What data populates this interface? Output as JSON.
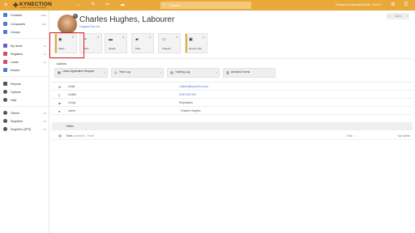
{
  "topbar": {
    "menu_icon": "hamburger-icon",
    "logo_text": "KYNECTION",
    "logo_tagline": "CONNECTING YOUR BUSINESS",
    "icons": [
      "back-arrow-icon",
      "edit-icon",
      "wrench-icon",
      "cloud-upload-icon"
    ],
    "search_placeholder": "Search",
    "user_label": "Everyone (Kynection/2018) / 1001 ▾",
    "right_icons": [
      "gear-icon",
      "menu-icon"
    ],
    "color": "#e8a93a"
  },
  "sidebar": {
    "items": [
      {
        "label": "Contacts",
        "count": "2011",
        "color": "#4a7bd0"
      },
      {
        "label": "Companies",
        "count": "201",
        "color": "#4a7bd0"
      },
      {
        "label": "Groups",
        "count": "",
        "color": "#4a7bd0"
      },
      {
        "label": "My Items",
        "count": "11",
        "color": "#6a5acd"
      },
      {
        "label": "Registers",
        "count": "11",
        "color": "#d04a6a"
      },
      {
        "label": "Leads",
        "count": "11",
        "color": "#d04a6a"
      },
      {
        "label": "Recent",
        "count": "",
        "color": "#4a7bd0"
      },
      {
        "label": "Reports",
        "count": "",
        "color": "#555555"
      },
      {
        "label": "Options",
        "count": "",
        "color": "#555555"
      },
      {
        "label": "Help",
        "count": "",
        "color": "#555555"
      },
      {
        "label": "Clients",
        "count": "15",
        "color": "#555555"
      },
      {
        "label": "Suppliers",
        "count": "14",
        "color": "#555555"
      },
      {
        "label": "Suppliers (ZPS)",
        "count": "11",
        "color": "#555555"
      }
    ]
  },
  "header": {
    "name": "Charles Hughes, Labourer",
    "company": "Hughes Pty Ltd",
    "pager": "1 of 1",
    "pager_prev": "‹",
    "pager_next": "›"
  },
  "cards": [
    {
      "label": "Sales",
      "count": "2",
      "icon": "sales-icon",
      "bar": "#e8a93a"
    },
    {
      "label": "Jobs",
      "count": "1",
      "icon": "wrench-icon",
      "bar": ""
    },
    {
      "label": "Issues",
      "count": "1",
      "icon": "issues-icon",
      "bar": ""
    },
    {
      "label": "Files",
      "count": "1",
      "icon": "folder-icon",
      "bar": ""
    },
    {
      "label": "Projects",
      "count": "1",
      "icon": "projects-icon",
      "bar": ""
    },
    {
      "label": "Quotes (16)",
      "count": "1",
      "icon": "quotes-icon",
      "bar": "#e8a93a"
    }
  ],
  "actions": {
    "title": "Actions",
    "buttons": [
      {
        "label": "Leave Application Request",
        "icon": "calendar-icon"
      },
      {
        "label": "Time Log",
        "icon": "clock-icon"
      },
      {
        "label": "Training Log",
        "icon": "book-icon"
      },
      {
        "label": "Archived Forms",
        "icon": "archive-icon"
      }
    ]
  },
  "details": [
    {
      "icon": "email-icon",
      "label": "email",
      "value": "charles@kynection.com",
      "link": true
    },
    {
      "icon": "phone-icon",
      "label": "mobile",
      "value": "0400 000 000",
      "link": true
    },
    {
      "icon": "group-icon",
      "label": "Group",
      "value": "Employees",
      "link": false
    },
    {
      "icon": "person-icon",
      "label": "owner",
      "value": "- Charles Hughes",
      "link": false
    }
  ],
  "notes": {
    "title": "Notes",
    "row": {
      "title": "Note | ",
      "subtitle": "example - email",
      "status": "Todo",
      "author": "Kyn Admin"
    }
  }
}
